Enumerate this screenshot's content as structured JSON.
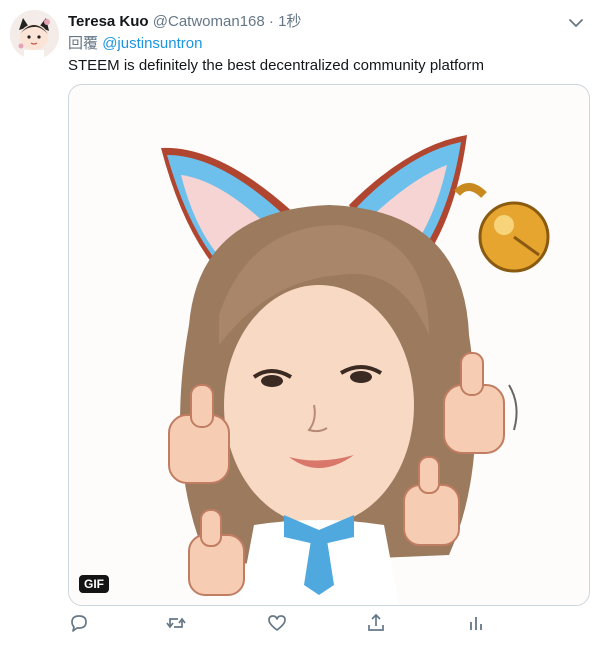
{
  "tweet": {
    "display_name": "Teresa Kuo",
    "handle": "@Catwoman168",
    "separator": "·",
    "time": "1秒",
    "reply_prefix": "回覆",
    "reply_to": "@justinsuntron",
    "text": "STEEM is definitely the best decentralized community platform",
    "media_badge": "GIF"
  },
  "icons": {
    "more": "chevron-down-icon",
    "reply": "reply-icon",
    "retweet": "retweet-icon",
    "like": "heart-icon",
    "share": "share-icon",
    "analytics": "analytics-icon"
  },
  "colors": {
    "link": "#1b95e0",
    "muted": "#657786",
    "text": "#14171a"
  }
}
